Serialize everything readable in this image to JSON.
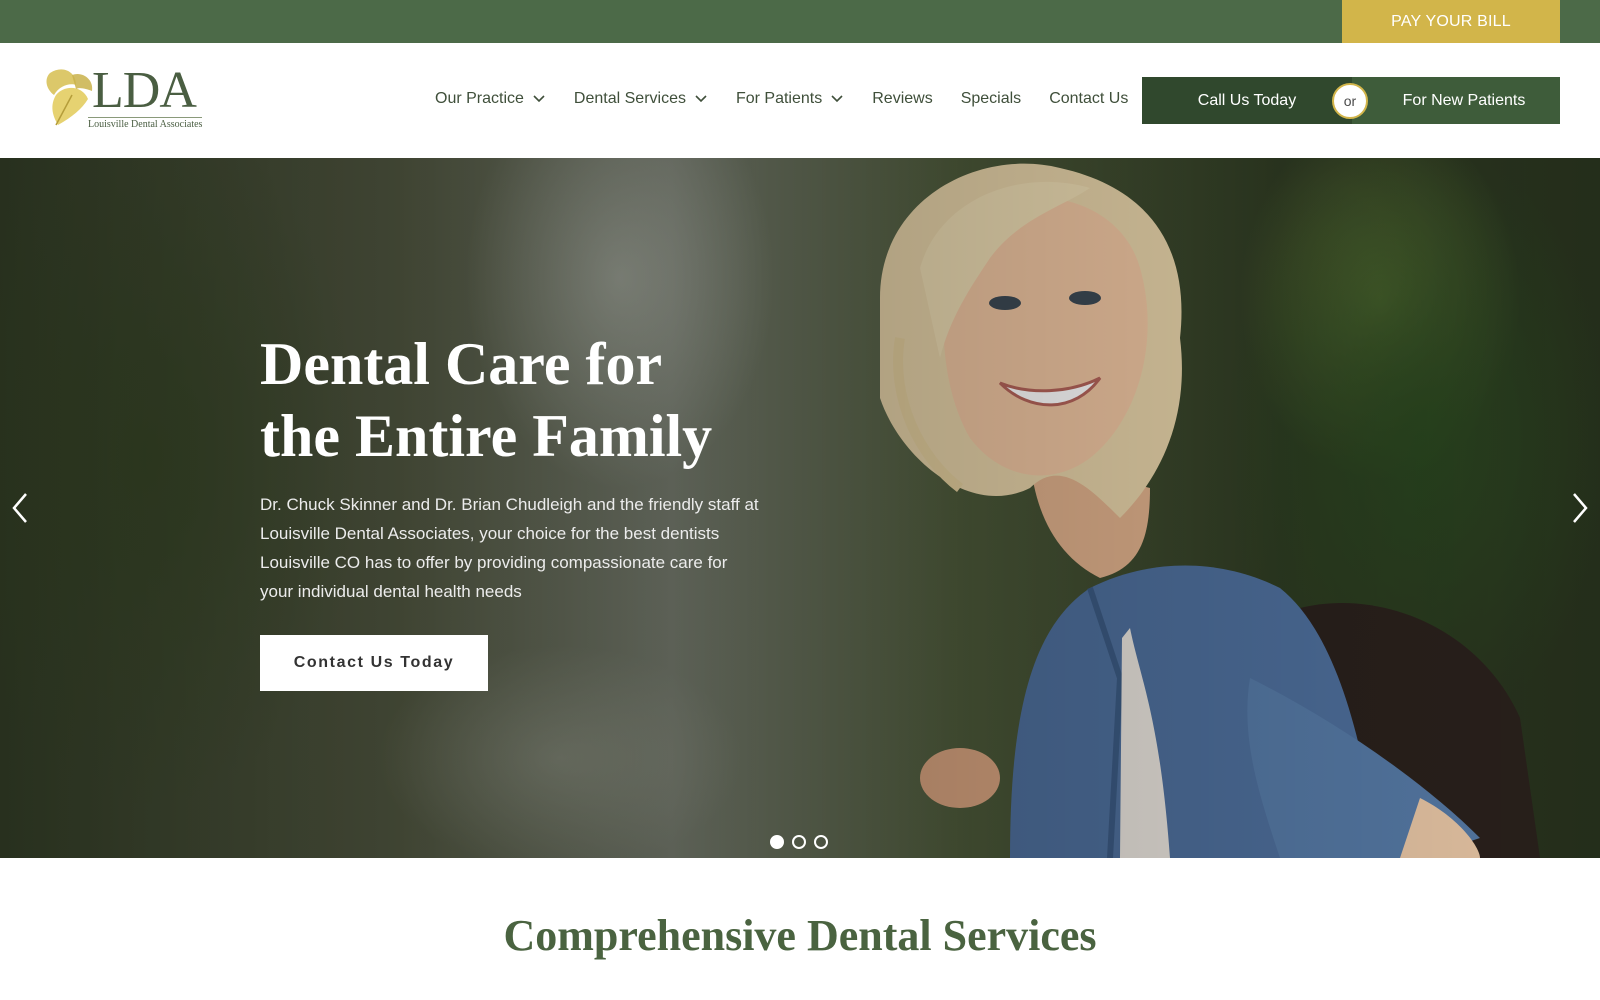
{
  "topbar": {
    "pay_bill_label": "PAY YOUR BILL"
  },
  "logo": {
    "letters": "LDA",
    "subtitle": "Louisville Dental Associates"
  },
  "nav": {
    "items": [
      {
        "label": "Our Practice",
        "has_dropdown": true
      },
      {
        "label": "Dental Services",
        "has_dropdown": true
      },
      {
        "label": "For Patients",
        "has_dropdown": true
      },
      {
        "label": "Reviews",
        "has_dropdown": false
      },
      {
        "label": "Specials",
        "has_dropdown": false
      },
      {
        "label": "Contact Us",
        "has_dropdown": false
      }
    ]
  },
  "cta": {
    "call_label": "Call Us Today",
    "or_label": "or",
    "new_patients_label": "For New Patients"
  },
  "hero": {
    "title_line1": "Dental Care for",
    "title_line2": "the Entire Family",
    "text": "Dr. Chuck Skinner and Dr. Brian Chudleigh and the friendly staff at Louisville Dental Associates, your choice for the best dentists Louisville CO has to offer by providing compassionate care for your individual dental health needs",
    "button_label": "Contact Us Today",
    "slides_total": 3,
    "active_slide": 1
  },
  "section": {
    "title": "Comprehensive Dental Services"
  },
  "colors": {
    "brand_green": "#4c6a48",
    "dark_green": "#30482d",
    "gold": "#d2b54a",
    "heading_green": "#4a6340"
  }
}
